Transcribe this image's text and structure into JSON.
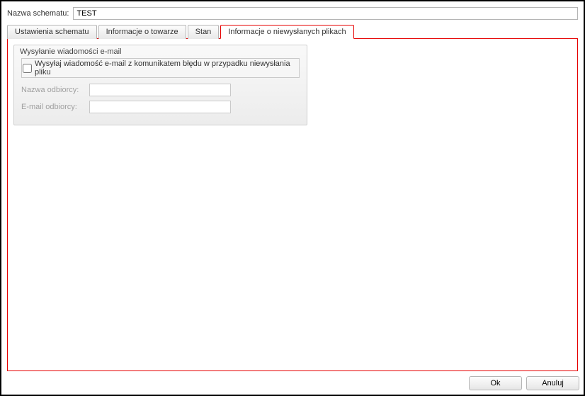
{
  "schema": {
    "label": "Nazwa schematu:",
    "value": "TEST"
  },
  "tabs": [
    {
      "label": "Ustawienia schematu"
    },
    {
      "label": "Informacje o towarze"
    },
    {
      "label": "Stan"
    },
    {
      "label": "Informacje o niewysłanych plikach"
    }
  ],
  "email_group": {
    "legend": "Wysyłanie wiadomości e-mail",
    "checkbox_label": "Wysyłaj wiadomość e-mail z komunikatem błędu w przypadku niewysłania pliku",
    "recipient_name_label": "Nazwa odbiorcy:",
    "recipient_name_value": "",
    "recipient_email_label": "E-mail odbiorcy:",
    "recipient_email_value": ""
  },
  "buttons": {
    "ok": "Ok",
    "cancel": "Anuluj"
  }
}
